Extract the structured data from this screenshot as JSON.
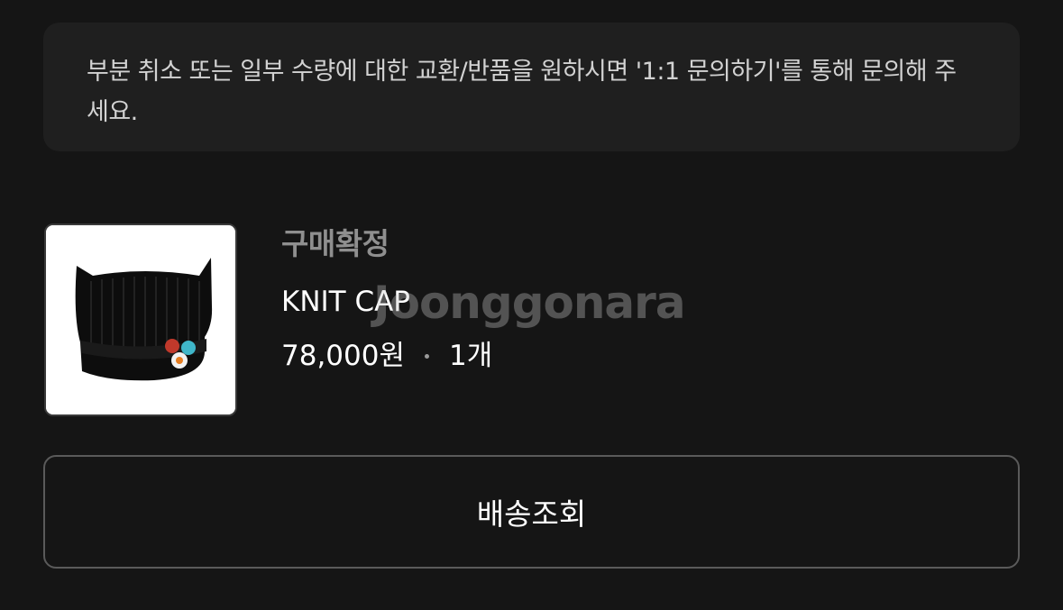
{
  "notice": {
    "text": "부분 취소 또는 일부 수량에 대한 교환/반품을 원하시면 '1:1 문의하기'를 통해 문의해 주세요."
  },
  "order": {
    "status": "구매확정",
    "product_name": "KNIT CAP",
    "price": "78,000원",
    "quantity": "1개",
    "watermark": "Joonggonara",
    "thumbnail_icon": "knit-cap-product-photo"
  },
  "actions": {
    "track_shipment_label": "배송조회"
  },
  "colors": {
    "background": "#151515",
    "notice_bg": "#1f1f1f",
    "status_gray": "#8f8f8f",
    "button_border": "#5a5a5a"
  }
}
